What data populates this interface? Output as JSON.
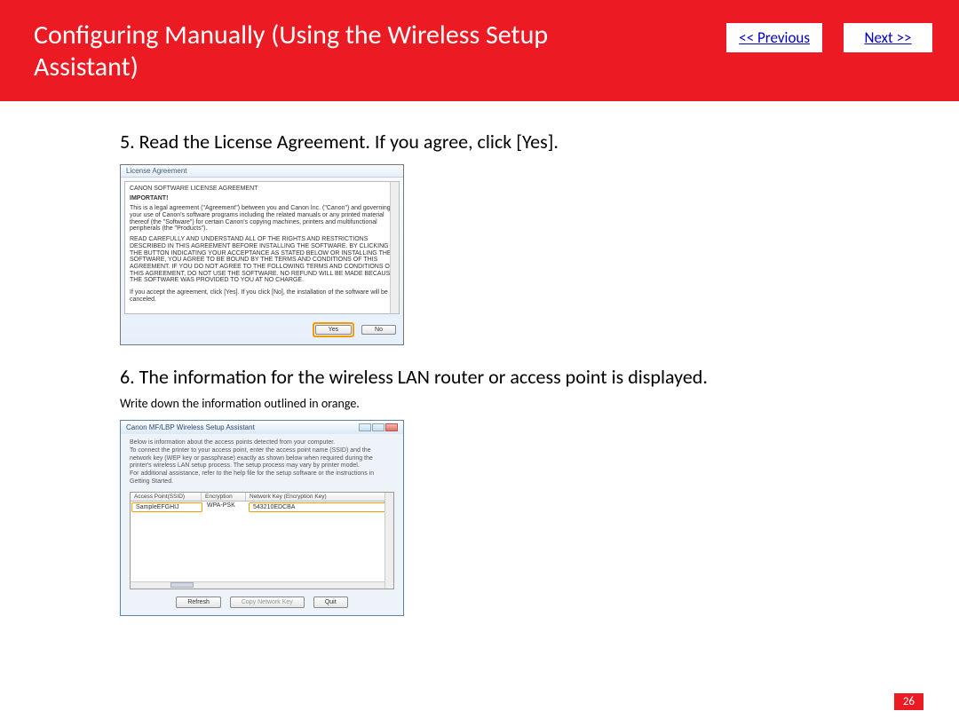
{
  "header": {
    "title": "Configuring Manually (Using the Wireless Setup Assistant)",
    "prev": "<< Previous",
    "next": "Next >>"
  },
  "steps": {
    "s5": {
      "title": "5. Read the License Agreement. If you agree, click [Yes].",
      "dialog": {
        "titlebar": "License Agreement",
        "line1": "CANON SOFTWARE LICENSE AGREEMENT",
        "important": "IMPORTANT!",
        "para1": "This is a legal agreement (\"Agreement\") between you and Canon Inc. (\"Canon\") and governing your use of Canon's software programs including the related manuals or any printed material thereof (the \"Software\") for certain Canon's copying machines, printers and multifunctional peripherals (the \"Products\").",
        "para2": "READ CAREFULLY AND UNDERSTAND ALL OF THE RIGHTS AND RESTRICTIONS DESCRIBED IN THIS AGREEMENT BEFORE INSTALLING THE SOFTWARE. BY CLICKING THE BUTTON INDICATING YOUR ACCEPTANCE AS STATED BELOW OR INSTALLING THE SOFTWARE, YOU AGREE TO BE BOUND BY THE TERMS AND CONDITIONS OF THIS AGREEMENT. IF YOU DO NOT AGREE TO THE FOLLOWING TERMS AND CONDITIONS OF THIS AGREEMENT, DO NOT USE THE SOFTWARE. NO REFUND WILL BE MADE BECAUSE THE SOFTWARE WAS PROVIDED TO YOU AT NO CHARGE.",
        "accept_line": "If you accept the agreement, click [Yes]. If you click [No], the installation of the software will be canceled.",
        "yes": "Yes",
        "no": "No"
      }
    },
    "s6": {
      "title": "6. The information for the wireless LAN router or access point is displayed.",
      "sub": "Write down the information outlined in orange.",
      "dialog": {
        "title": "Canon MF/LBP Wireless Setup Assistant",
        "desc": "Below is information about the access points detected from your computer.\nTo connect the printer to your access point, enter the access point name (SSID) and the network key (WEP key or passphrase) exactly as shown below when required during the printer's wireless LAN setup process. The setup process may vary by printer model.\nFor additional assistance, refer to the help file for the setup software or the instructions in Getting Started.",
        "col_ap": "Access Point(SSID)",
        "col_enc": "Encryption",
        "col_key": "Network Key (Encryption Key)",
        "row": {
          "ssid": "SampleEFGHIJ",
          "enc": "WPA-PSK",
          "key": "543210EDCBA"
        },
        "refresh": "Refresh",
        "copy": "Copy Network Key",
        "quit": "Quit"
      }
    }
  },
  "page_number": "26"
}
